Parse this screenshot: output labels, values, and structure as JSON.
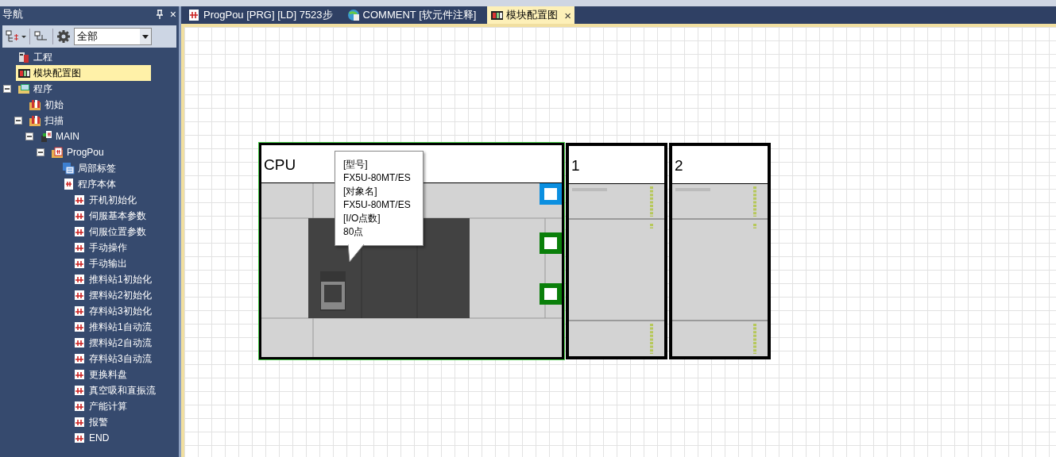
{
  "navigation": {
    "title": "导航",
    "close": "×",
    "filter": {
      "value": "全部"
    },
    "tree": [
      {
        "label": "工程",
        "kind": "project",
        "selected": false
      },
      {
        "label": "模块配置图",
        "kind": "config",
        "selected": true
      },
      {
        "label": "程序",
        "kind": "program",
        "selected": false,
        "expanded": true,
        "children": [
          {
            "label": "初始",
            "kind": "task",
            "selected": false
          },
          {
            "label": "扫描",
            "kind": "task",
            "selected": false,
            "expanded": true,
            "children": [
              {
                "label": "MAIN",
                "kind": "main",
                "selected": false,
                "expanded": true,
                "children": [
                  {
                    "label": "ProgPou",
                    "kind": "pou",
                    "selected": false,
                    "expanded": true,
                    "children": [
                      {
                        "label": "局部标签",
                        "kind": "labels",
                        "selected": false
                      },
                      {
                        "label": "程序本体",
                        "kind": "body",
                        "selected": false,
                        "children": [
                          {
                            "label": "开机初始化",
                            "kind": "ladder",
                            "selected": false
                          },
                          {
                            "label": "伺服基本参数",
                            "kind": "ladder",
                            "selected": false
                          },
                          {
                            "label": "伺服位置参数",
                            "kind": "ladder",
                            "selected": false
                          },
                          {
                            "label": "手动操作",
                            "kind": "ladder",
                            "selected": false
                          },
                          {
                            "label": "手动输出",
                            "kind": "ladder",
                            "selected": false
                          },
                          {
                            "label": "推料站1初始化",
                            "kind": "ladder",
                            "selected": false
                          },
                          {
                            "label": "摆料站2初始化",
                            "kind": "ladder",
                            "selected": false
                          },
                          {
                            "label": "存料站3初始化",
                            "kind": "ladder",
                            "selected": false
                          },
                          {
                            "label": "推料站1自动流",
                            "kind": "ladder",
                            "selected": false
                          },
                          {
                            "label": "摆料站2自动流",
                            "kind": "ladder",
                            "selected": false
                          },
                          {
                            "label": "存料站3自动流",
                            "kind": "ladder",
                            "selected": false
                          },
                          {
                            "label": "更换料盘",
                            "kind": "ladder",
                            "selected": false
                          },
                          {
                            "label": "真空吸和直振流",
                            "kind": "ladder",
                            "selected": false
                          },
                          {
                            "label": "产能计算",
                            "kind": "ladder",
                            "selected": false
                          },
                          {
                            "label": "报警",
                            "kind": "ladder",
                            "selected": false
                          },
                          {
                            "label": "END",
                            "kind": "ladder",
                            "selected": false
                          }
                        ]
                      }
                    ]
                  }
                ]
              }
            ]
          }
        ]
      }
    ]
  },
  "tabs": [
    {
      "label": "ProgPou [PRG] [LD] 7523步",
      "kind": "ladder",
      "selected": false
    },
    {
      "label": "COMMENT [软元件注释]",
      "kind": "comment",
      "selected": false
    },
    {
      "label": "模块配置图",
      "kind": "config",
      "selected": true,
      "close": "×"
    }
  ],
  "modules": [
    {
      "label": "CPU",
      "kind": "cpu",
      "ports": [
        {
          "color": "#0b8fe0"
        },
        {
          "color": "#0a7f0a"
        },
        {
          "color": "#0a7f0a"
        }
      ]
    },
    {
      "label": "1",
      "kind": "io"
    },
    {
      "label": "2",
      "kind": "io"
    }
  ],
  "tooltip": {
    "lines": [
      "[型号]",
      "FX5U-80MT/ES",
      "[对象名]",
      "FX5U-80MT/ES",
      "[I/O点数]",
      "80点"
    ]
  }
}
